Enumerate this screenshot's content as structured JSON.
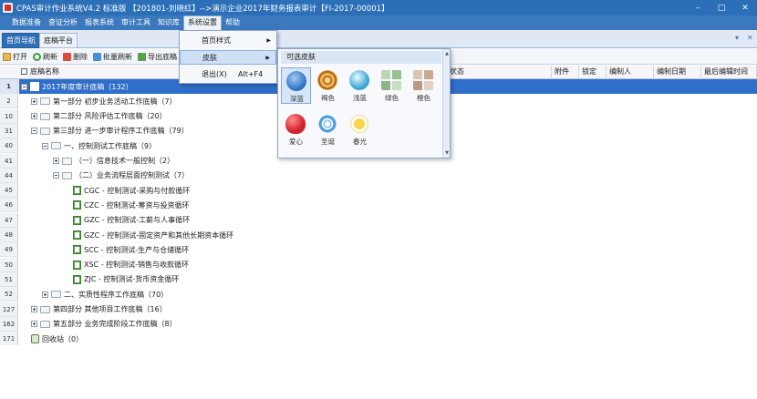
{
  "window": {
    "title": "CPAS审计作业系统V4.2 标准版 【201801-刘晓红】-->演示企业2017年财务报表审计【FI-2017-00001】",
    "controls": [
      "–",
      "□",
      "✕"
    ]
  },
  "menubar": {
    "items": [
      {
        "label": "数据准备",
        "active": false
      },
      {
        "label": "查证分析",
        "active": false
      },
      {
        "label": "报表系统",
        "active": false
      },
      {
        "label": "审计工具",
        "active": false
      },
      {
        "label": "知识库",
        "active": false
      },
      {
        "label": "系统设置",
        "active": true
      },
      {
        "label": "帮助",
        "active": false
      }
    ]
  },
  "tabs": [
    {
      "label": "首页导航",
      "active": true
    },
    {
      "label": "底稿平台",
      "active": false
    }
  ],
  "tab_controls": {
    "dropdown": "▾",
    "close": "✕"
  },
  "toolbar": {
    "open": "打开",
    "refresh": "刷新",
    "delete": "删除",
    "batch_refresh": "批量刷新",
    "export": "导出底稿"
  },
  "columns": {
    "name": "底稿名称",
    "status": "状态",
    "attachment": "附件",
    "lock": "锁定",
    "author": "编制人",
    "date": "编制日期",
    "last_edit": "最后编辑时间"
  },
  "tree_rows": [
    {
      "num": "1",
      "label": "2017年度审计底稿（132）",
      "selected": true
    },
    {
      "num": "2",
      "label": "第一部分  初步业务活动工作底稿（7）"
    },
    {
      "num": "10",
      "label": "第二部分  风险评估工作底稿（20）"
    },
    {
      "num": "31",
      "label": "第三部分  进一步审计程序工作底稿（79）"
    },
    {
      "num": "40",
      "label": "一、控制测试工作底稿（9）"
    },
    {
      "num": "41",
      "label": "（一）信息技术一般控制（2）"
    },
    {
      "num": "44",
      "label": "（二）业务流程层面控制测试（7）"
    },
    {
      "num": "45",
      "label": "CGC - 控制测试-采购与付款循环"
    },
    {
      "num": "46",
      "label": "CZC - 控制测试-筹资与投资循环"
    },
    {
      "num": "47",
      "label": "GZC - 控制测试-工薪与人事循环"
    },
    {
      "num": "48",
      "label": "GZC - 控制测试-固定资产和其他长期资本循环"
    },
    {
      "num": "49",
      "label": "SCC - 控制测试-生产与仓储循环"
    },
    {
      "num": "50",
      "label": "XSC - 控制测试-销售与收款循环"
    },
    {
      "num": "51",
      "label": "ZJC - 控制测试-货币资金循环"
    },
    {
      "num": "52",
      "label": "二、实质性程序工作底稿（70）"
    },
    {
      "num": "127",
      "label": "第四部分  其他项目工作底稿（16）"
    },
    {
      "num": "162",
      "label": "第五部分  业务完成阶段工作底稿（8）"
    },
    {
      "num": "171",
      "label": "回收站（0）"
    }
  ],
  "dropdown": {
    "homepage_style": "首页样式",
    "skin": "皮肤",
    "exit": "退出(X)",
    "exit_shortcut": "Alt+F4"
  },
  "skins_panel": {
    "title": "可选皮肤",
    "items": [
      {
        "label": "深蓝",
        "selected": true
      },
      {
        "label": "褐色"
      },
      {
        "label": "浅蓝"
      },
      {
        "label": "绿色"
      },
      {
        "label": "橙色"
      },
      {
        "label": "爱心"
      },
      {
        "label": "圣诞"
      },
      {
        "label": "春光"
      }
    ]
  }
}
